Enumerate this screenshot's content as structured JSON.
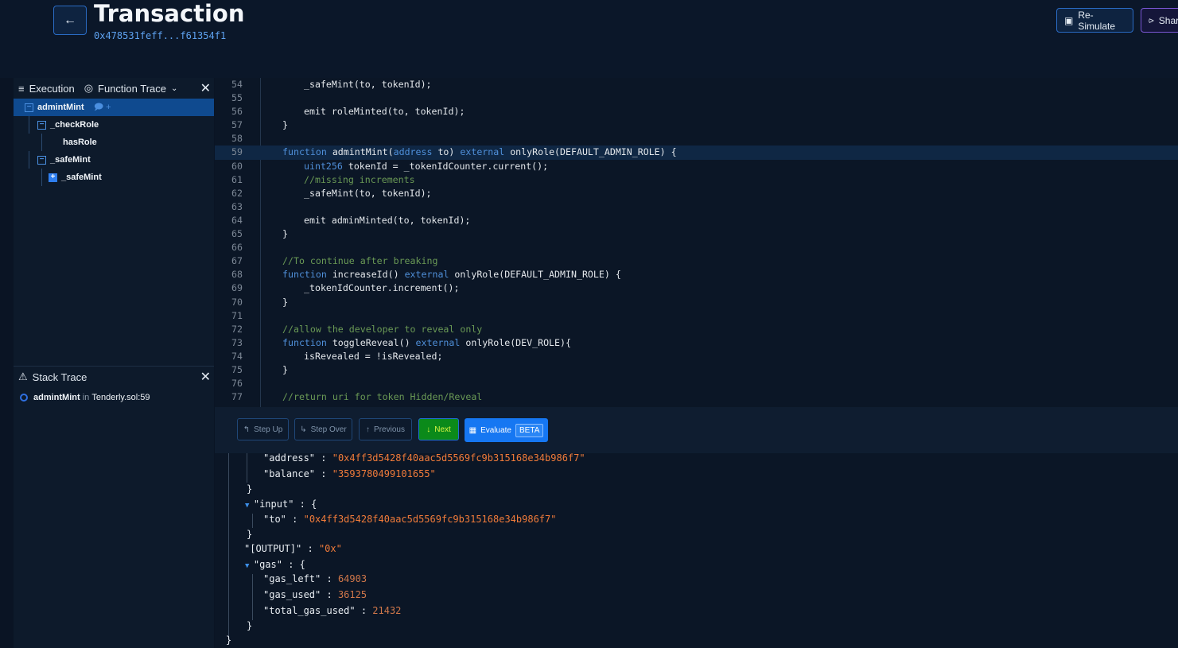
{
  "header": {
    "title": "Transaction",
    "hash": "0x478531feff...f61354f1",
    "resimulate": "Re-Simulate",
    "share": "Share"
  },
  "left": {
    "tabs": [
      {
        "label": "Execution",
        "icon": "list-icon"
      },
      {
        "label": "Function Trace",
        "icon": "target-icon"
      }
    ],
    "tree": [
      {
        "label": "admintMint",
        "depth": 0,
        "toggle": "minus",
        "selected": true
      },
      {
        "label": "_checkRole",
        "depth": 1,
        "toggle": "minus"
      },
      {
        "label": "hasRole",
        "depth": 2,
        "toggle": ""
      },
      {
        "label": "_safeMint",
        "depth": 1,
        "toggle": "minus"
      },
      {
        "label": "_safeMint",
        "depth": 2,
        "toggle": "plus"
      }
    ],
    "stack": {
      "title": "Stack Trace",
      "fn": "admintMint",
      "in": "in",
      "loc": "Tenderly.sol:59"
    }
  },
  "code": {
    "highlight_line": 59,
    "lines": [
      {
        "n": "54",
        "i": 2,
        "t": [
          [
            "tx",
            "_safeMint(to, tokenId);"
          ]
        ]
      },
      {
        "n": "55",
        "i": 0,
        "t": []
      },
      {
        "n": "56",
        "i": 2,
        "t": [
          [
            "tx",
            "emit roleMinted(to, tokenId);"
          ]
        ]
      },
      {
        "n": "57",
        "i": 1,
        "t": [
          [
            "tx",
            "}"
          ]
        ]
      },
      {
        "n": "58",
        "i": 0,
        "t": []
      },
      {
        "n": "59",
        "i": 1,
        "t": [
          [
            "kw",
            "function "
          ],
          [
            "tx",
            "admintMint("
          ],
          [
            "kw",
            "address "
          ],
          [
            "tx",
            "to) "
          ],
          [
            "kw",
            "external "
          ],
          [
            "tx",
            "onlyRole(DEFAULT_ADMIN_ROLE) {"
          ]
        ]
      },
      {
        "n": "60",
        "i": 2,
        "t": [
          [
            "kw",
            "uint256 "
          ],
          [
            "tx",
            "tokenId = _tokenIdCounter.current();"
          ]
        ]
      },
      {
        "n": "61",
        "i": 2,
        "t": [
          [
            "cm",
            "//missing increments"
          ]
        ]
      },
      {
        "n": "62",
        "i": 2,
        "t": [
          [
            "tx",
            "_safeMint(to, tokenId);"
          ]
        ]
      },
      {
        "n": "63",
        "i": 0,
        "t": []
      },
      {
        "n": "64",
        "i": 2,
        "t": [
          [
            "tx",
            "emit adminMinted(to, tokenId);"
          ]
        ]
      },
      {
        "n": "65",
        "i": 1,
        "t": [
          [
            "tx",
            "}"
          ]
        ]
      },
      {
        "n": "66",
        "i": 0,
        "t": []
      },
      {
        "n": "67",
        "i": 1,
        "t": [
          [
            "cm",
            "//To continue after breaking"
          ]
        ]
      },
      {
        "n": "68",
        "i": 1,
        "t": [
          [
            "kw",
            "function "
          ],
          [
            "tx",
            "increaseId() "
          ],
          [
            "kw",
            "external "
          ],
          [
            "tx",
            "onlyRole(DEFAULT_ADMIN_ROLE) {"
          ]
        ]
      },
      {
        "n": "69",
        "i": 2,
        "t": [
          [
            "tx",
            "_tokenIdCounter.increment();"
          ]
        ]
      },
      {
        "n": "70",
        "i": 1,
        "t": [
          [
            "tx",
            "}"
          ]
        ]
      },
      {
        "n": "71",
        "i": 0,
        "t": []
      },
      {
        "n": "72",
        "i": 1,
        "t": [
          [
            "cm",
            "//allow the developer to reveal only"
          ]
        ]
      },
      {
        "n": "73",
        "i": 1,
        "t": [
          [
            "kw",
            "function "
          ],
          [
            "tx",
            "toggleReveal() "
          ],
          [
            "kw",
            "external "
          ],
          [
            "tx",
            "onlyRole(DEV_ROLE){"
          ]
        ]
      },
      {
        "n": "74",
        "i": 2,
        "t": [
          [
            "tx",
            "isRevealed = !isRevealed;"
          ]
        ]
      },
      {
        "n": "75",
        "i": 1,
        "t": [
          [
            "tx",
            "}"
          ]
        ]
      },
      {
        "n": "76",
        "i": 0,
        "t": []
      },
      {
        "n": "77",
        "i": 1,
        "t": [
          [
            "cm",
            "//return uri for token Hidden/Reveal"
          ]
        ]
      }
    ]
  },
  "toolbar": {
    "step_up": "Step Up",
    "step_over": "Step Over",
    "previous": "Previous",
    "next": "Next",
    "evaluate": "Evaluate",
    "beta": "BETA"
  },
  "json": [
    {
      "d": 2,
      "t": [
        [
          "k",
          "\"address\""
        ],
        [
          "p",
          " : "
        ],
        [
          "s",
          "\"0x4ff3d5428f40aac5d5569fc9b315168e34b986f7\""
        ]
      ]
    },
    {
      "d": 2,
      "t": [
        [
          "k",
          "\"balance\""
        ],
        [
          "p",
          " : "
        ],
        [
          "s",
          "\"3593780499101655\""
        ]
      ]
    },
    {
      "d": 1,
      "t": [
        [
          "p",
          "}"
        ]
      ]
    },
    {
      "d": 1,
      "tog": true,
      "t": [
        [
          "k",
          "\"input\""
        ],
        [
          "p",
          " : {"
        ]
      ]
    },
    {
      "d": 2,
      "t": [
        [
          "k",
          "\"to\""
        ],
        [
          "p",
          " : "
        ],
        [
          "s",
          "\"0x4ff3d5428f40aac5d5569fc9b315168e34b986f7\""
        ]
      ]
    },
    {
      "d": 1,
      "t": [
        [
          "p",
          "}"
        ]
      ]
    },
    {
      "d": 1,
      "t": [
        [
          "k",
          "\"[OUTPUT]\""
        ],
        [
          "p",
          " : "
        ],
        [
          "s",
          "\"0x\""
        ]
      ]
    },
    {
      "d": 1,
      "tog": true,
      "t": [
        [
          "k",
          "\"gas\""
        ],
        [
          "p",
          " : {"
        ]
      ]
    },
    {
      "d": 2,
      "t": [
        [
          "k",
          "\"gas_left\""
        ],
        [
          "p",
          " : "
        ],
        [
          "n",
          "64903"
        ]
      ]
    },
    {
      "d": 2,
      "t": [
        [
          "k",
          "\"gas_used\""
        ],
        [
          "p",
          " : "
        ],
        [
          "n",
          "36125"
        ]
      ]
    },
    {
      "d": 2,
      "t": [
        [
          "k",
          "\"total_gas_used\""
        ],
        [
          "p",
          " : "
        ],
        [
          "n",
          "21432"
        ]
      ]
    },
    {
      "d": 1,
      "t": [
        [
          "p",
          "}"
        ]
      ]
    },
    {
      "d": 0,
      "t": [
        [
          "p",
          "}"
        ]
      ]
    }
  ]
}
